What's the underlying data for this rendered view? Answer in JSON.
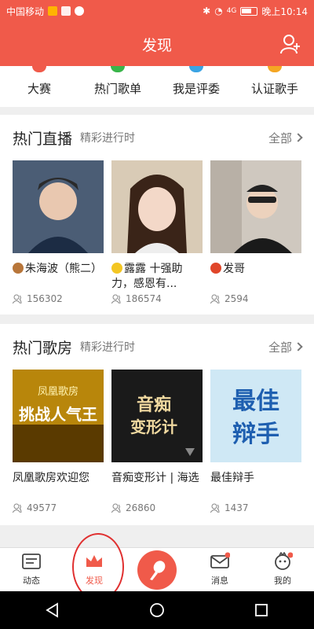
{
  "status_bar": {
    "carrier": "中国移动",
    "time": "晚上10:14",
    "network": "4G"
  },
  "header": {
    "title": "发现"
  },
  "quick_links": [
    {
      "label": "大赛",
      "color": "#f05a4a"
    },
    {
      "label": "热门歌单",
      "color": "#39b54a"
    },
    {
      "label": "我是评委",
      "color": "#3aa3e3"
    },
    {
      "label": "认证歌手",
      "color": "#f5a623"
    }
  ],
  "live": {
    "title": "热门直播",
    "subtitle": "精彩进行时",
    "all_label": "全部",
    "cards": [
      {
        "title": "朱海波（熊二）",
        "viewers": "156302",
        "emoji": "#b8763a"
      },
      {
        "title": "露露 十强助力，感恩有...",
        "viewers": "186574",
        "emoji": "#f3c623"
      },
      {
        "title": "发哥",
        "viewers": "2594",
        "emoji": "#e0462a"
      }
    ]
  },
  "rooms": {
    "title": "热门歌房",
    "subtitle": "精彩进行时",
    "all_label": "全部",
    "cards": [
      {
        "title": "凤凰歌房欢迎您",
        "viewers": "49577",
        "art_top": "凤凰歌房",
        "art_main": "挑战人气王"
      },
      {
        "title": "音痴变形计 | 海选",
        "viewers": "26860",
        "art_top": "音痴",
        "art_main": "变形计"
      },
      {
        "title": "最佳辩手",
        "viewers": "1437",
        "art_top": "最佳",
        "art_main": "辩手"
      }
    ]
  },
  "bottom_nav": [
    {
      "label": "动态"
    },
    {
      "label": "发现"
    },
    {
      "label": "消息"
    },
    {
      "label": "我的"
    }
  ]
}
